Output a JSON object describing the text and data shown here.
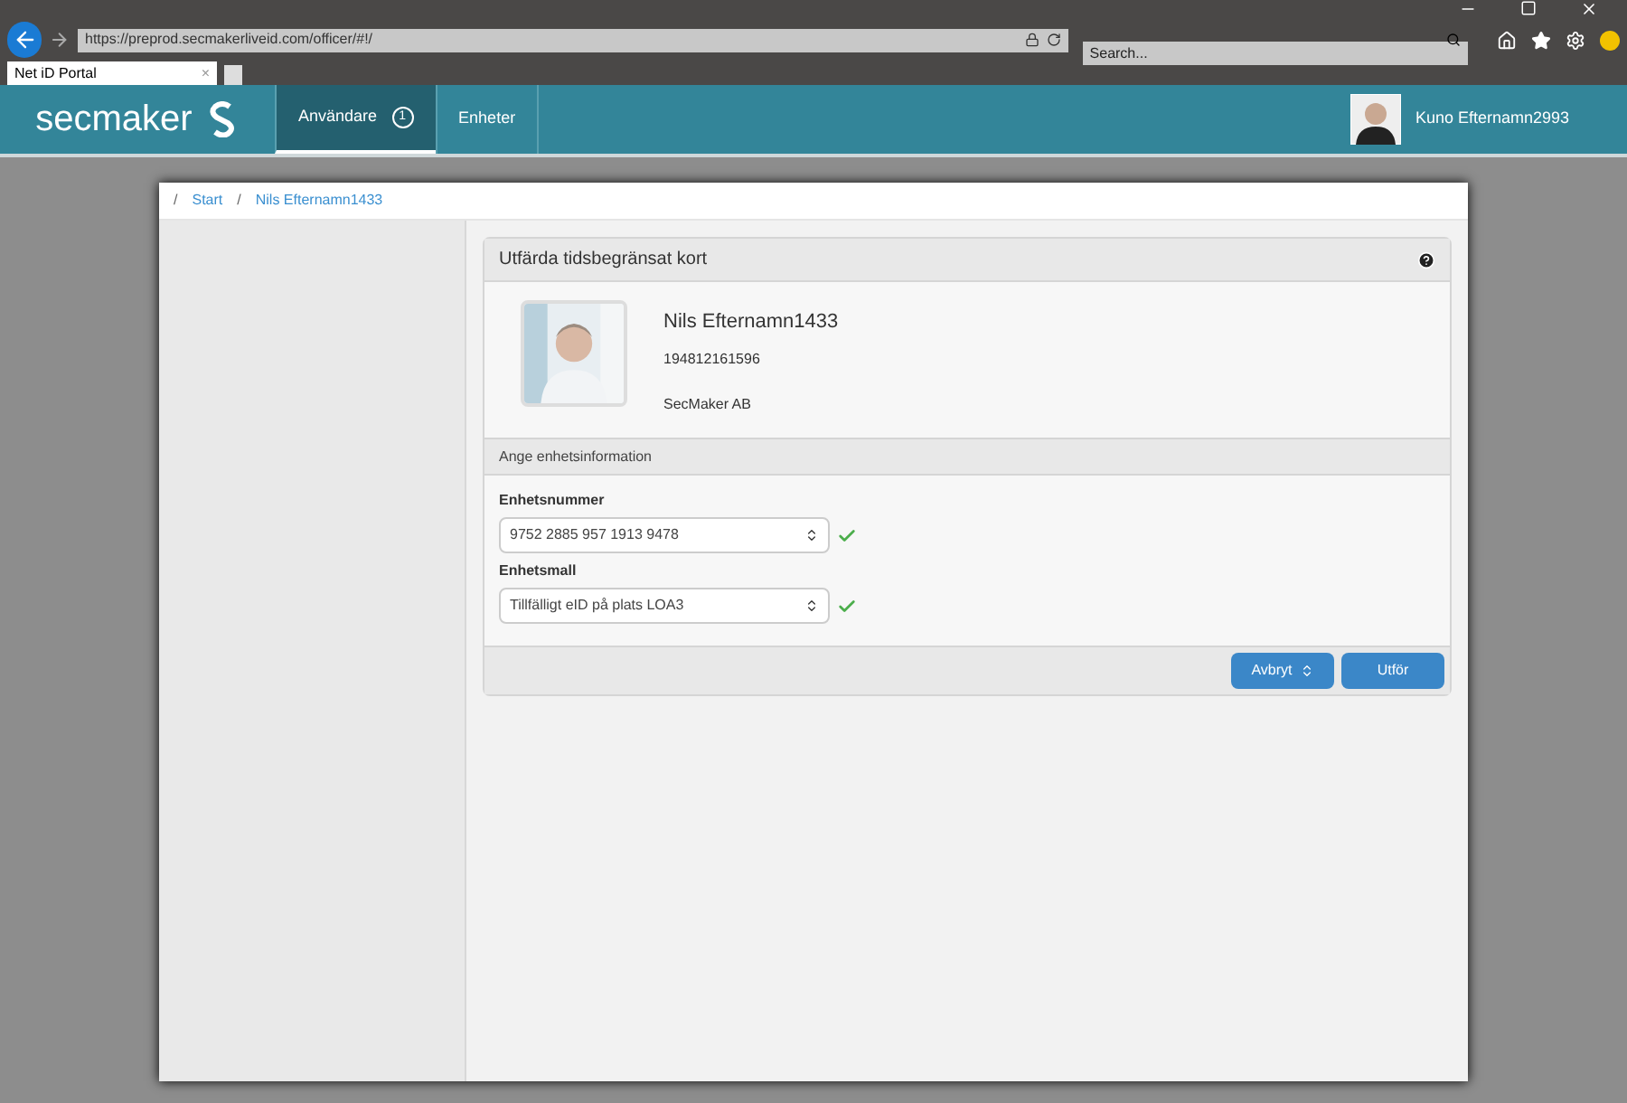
{
  "browser": {
    "url": "https://preprod.secmakerliveid.com/officer/#!/",
    "search": {
      "placeholder": "Search..."
    },
    "tab": {
      "title": "Net iD Portal",
      "close": "×"
    }
  },
  "nav": {
    "brand": "secmaker",
    "items": [
      {
        "label": "Användare",
        "badge": "1",
        "selected": true
      },
      {
        "label": "Enheter",
        "selected": false
      }
    ],
    "user": "Kuno Efternamn2993"
  },
  "breadcrumb": {
    "separator": "/",
    "items": [
      "Start",
      "Nils Efternamn1433"
    ]
  },
  "card": {
    "title": "Utfärda tidsbegränsat kort",
    "person": {
      "name": "Nils Efternamn1433",
      "id": "194812161596",
      "org": "SecMaker AB"
    },
    "section": "Ange enhetsinformation",
    "fields": [
      {
        "label": "Enhetsnummer",
        "value": "9752 2885 957 1913 9478",
        "valid": true
      },
      {
        "label": "Enhetsmall",
        "value": "Tillfälligt eID på plats LOA3",
        "valid": true
      }
    ],
    "buttons": [
      {
        "label": "Avbryt",
        "kind": "dropdown"
      },
      {
        "label": "Utför",
        "kind": "plain"
      }
    ]
  }
}
